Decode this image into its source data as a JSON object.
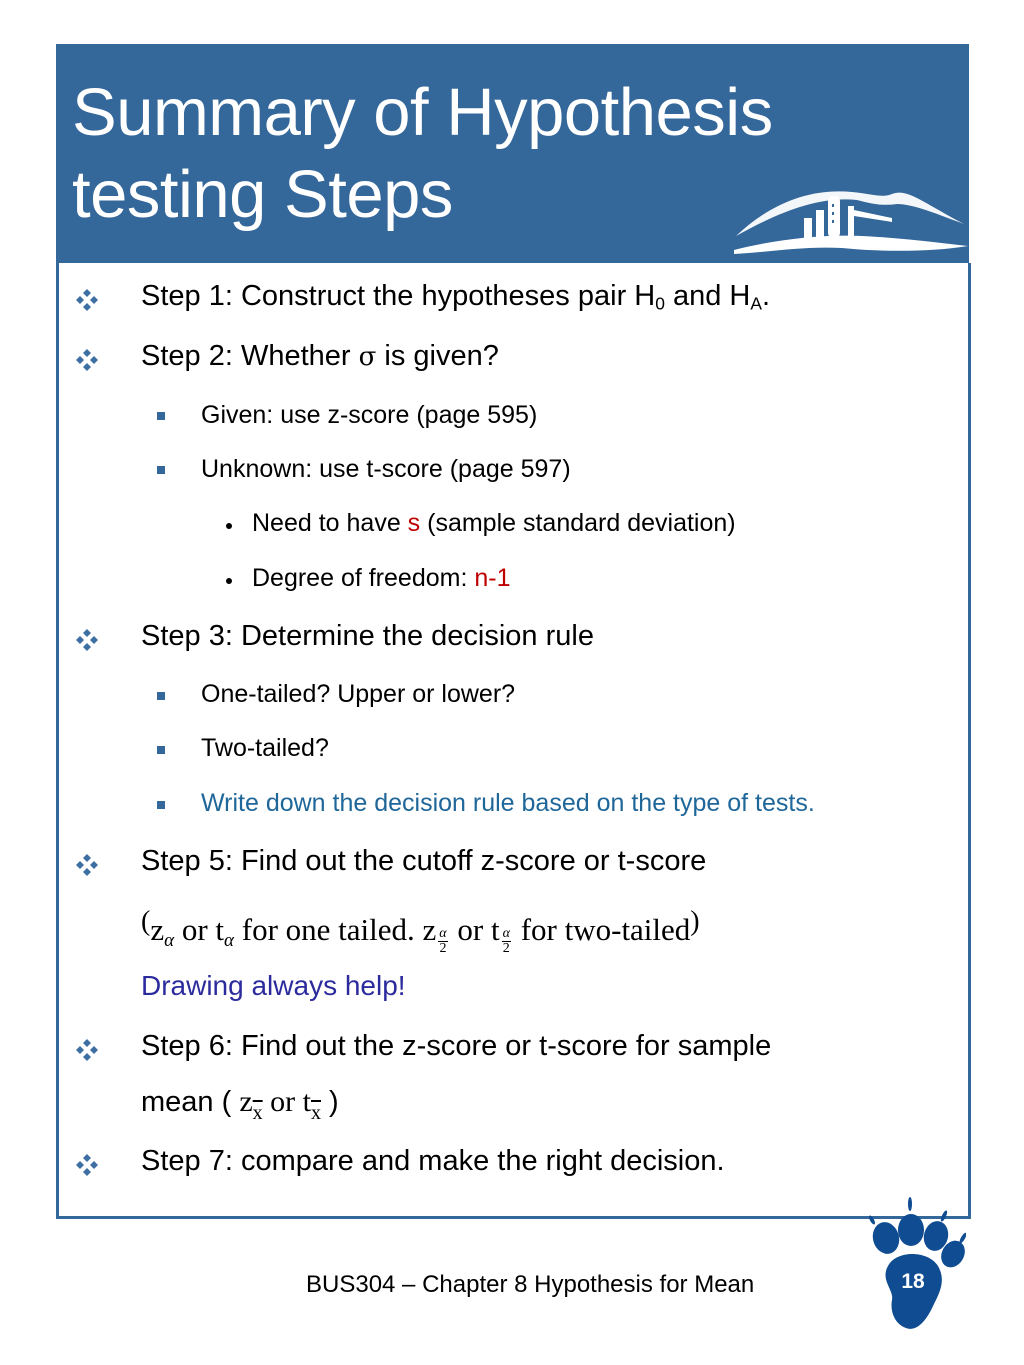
{
  "slide": {
    "title_line1": "Summary of Hypothesis",
    "title_line2": "testing Steps",
    "accent_color": "#34679a",
    "highlight_red": "#c00000",
    "highlight_blue": "#1f6699"
  },
  "bullets": {
    "step1": {
      "text": "Step 1: Construct the hypotheses pair H",
      "sub0": "0",
      "mid": " and H",
      "subA": "A",
      "end": "."
    },
    "step2": {
      "pre": "Step 2: Whether ",
      "sigma": "σ",
      "post": " is given?"
    },
    "given": "Given: use z-score (page 595)",
    "unknown": "Unknown: use t-score (page 597)",
    "need_pre": "Need to have ",
    "need_s": "s",
    "need_post": " (sample standard deviation)",
    "dof_pre": "Degree of freedom: ",
    "dof_val": "n-1",
    "step3": "Step 3: Determine the decision rule",
    "one_tailed": "One-tailed? Upper or lower?",
    "two_tailed": "Two-tailed?",
    "write_down": "Write down the decision rule based on the type of tests.",
    "step5": "Step 5: Find out the cutoff z-score or t-score",
    "formula": {
      "open": "(",
      "z": "z",
      "alpha": "α",
      "or": " or ",
      "t": "t",
      "one_tailed": " for one tailed. ",
      "two": "2",
      "two_tailed": " for two-tailed",
      "close": ")"
    },
    "drawing": "Drawing always help!",
    "step6_line1": "Step 6: Find out the z-score or t-score for sample",
    "step6_line2_pre": "mean ( ",
    "step6_z": "z",
    "step6_x": "x",
    "step6_or": " or ",
    "step6_t": "t",
    "step6_close": " )",
    "step7": "Step 7: compare and make the right decision."
  },
  "footer": {
    "course": "BUS304 – Chapter 8 Hypothesis for Mean",
    "page_number": "18"
  }
}
